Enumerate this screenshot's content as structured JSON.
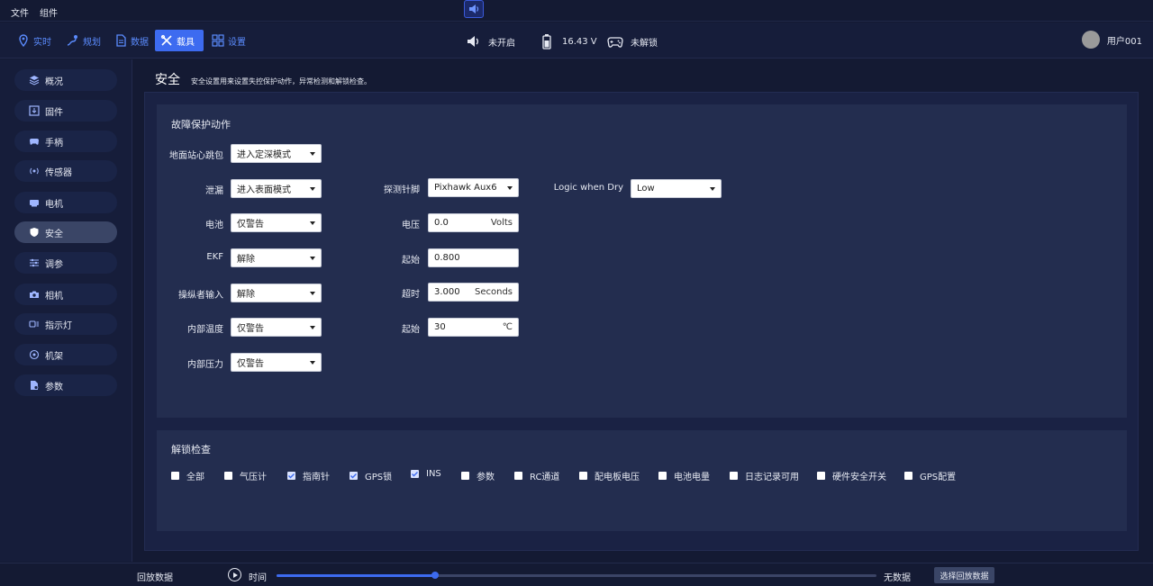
{
  "menu": {
    "file": "文件",
    "component": "组件"
  },
  "toolbar": {
    "tabs": [
      "实时",
      "规划",
      "数据",
      "载具",
      "设置"
    ],
    "active_tab": "载具",
    "status": {
      "sound": "未开启",
      "battery": "16.43 V",
      "lock": "未解锁"
    },
    "user": "用户001"
  },
  "sidebar": {
    "items": [
      "概况",
      "固件",
      "手柄",
      "传感器",
      "电机",
      "安全",
      "调参",
      "相机",
      "指示灯",
      "机架",
      "参数"
    ],
    "active": "安全"
  },
  "page": {
    "title": "安全",
    "description": "安全设置用来设置失控保护动作，异常检测和解锁检查。"
  },
  "failsafe": {
    "title": "故障保护动作",
    "gcs_heartbeat": {
      "label": "地面站心跳包",
      "value": "进入定深模式"
    },
    "leak": {
      "label": "泄漏",
      "value": "进入表面模式"
    },
    "battery": {
      "label": "电池",
      "value": "仅警告"
    },
    "ekf": {
      "label": "EKF",
      "value": "解除"
    },
    "pilot_input": {
      "label": "操纵者输入",
      "value": "解除"
    },
    "internal_temp": {
      "label": "内部温度",
      "value": "仅警告"
    },
    "internal_pressure": {
      "label": "内部压力",
      "value": "仅警告"
    },
    "detector_pin": {
      "label": "探测针脚",
      "value": "Pixhawk Aux6"
    },
    "voltage": {
      "label": "电压",
      "value": "0.0",
      "unit": "Volts"
    },
    "start1": {
      "label": "起始",
      "value": "0.800"
    },
    "timeout": {
      "label": "超时",
      "value": "3.000",
      "unit": "Seconds"
    },
    "start2": {
      "label": "起始",
      "value": "30",
      "unit": "℃"
    },
    "logic_when_dry": {
      "label": "Logic when Dry",
      "value": "Low"
    }
  },
  "arming": {
    "title": "解锁检查",
    "checks": [
      {
        "label": "全部",
        "checked": false
      },
      {
        "label": "气压计",
        "checked": false
      },
      {
        "label": "指南针",
        "checked": true
      },
      {
        "label": "GPS锁",
        "checked": true
      },
      {
        "label": "INS",
        "checked": true
      },
      {
        "label": "参数",
        "checked": false
      },
      {
        "label": "RC通道",
        "checked": false
      },
      {
        "label": "配电板电压",
        "checked": false
      },
      {
        "label": "电池电量",
        "checked": false
      },
      {
        "label": "日志记录可用",
        "checked": false
      },
      {
        "label": "硬件安全开关",
        "checked": false
      },
      {
        "label": "GPS配置",
        "checked": false
      }
    ]
  },
  "playback": {
    "label": "回放数据",
    "time_label": "时间",
    "progress": 0.265,
    "no_data": "无数据",
    "select_button": "选择回放数据"
  },
  "colors": {
    "accent": "#3d6bf0",
    "link": "#5b8cff",
    "background": "#141a33",
    "panel": "#232d4f"
  },
  "icons": {
    "top_speaker": "speaker-icon",
    "tabs": [
      "location-pin-icon",
      "route-icon",
      "document-icon",
      "tools-icon",
      "grid-icon"
    ],
    "status": [
      "speaker-icon",
      "battery-icon",
      "gamepad-icon"
    ],
    "sidebar": [
      "layers-icon",
      "firmware-icon",
      "gamepad-icon",
      "sensor-icon",
      "motor-icon",
      "shield-icon",
      "tune-icon",
      "camera-icon",
      "light-icon",
      "frame-icon",
      "params-icon"
    ]
  }
}
